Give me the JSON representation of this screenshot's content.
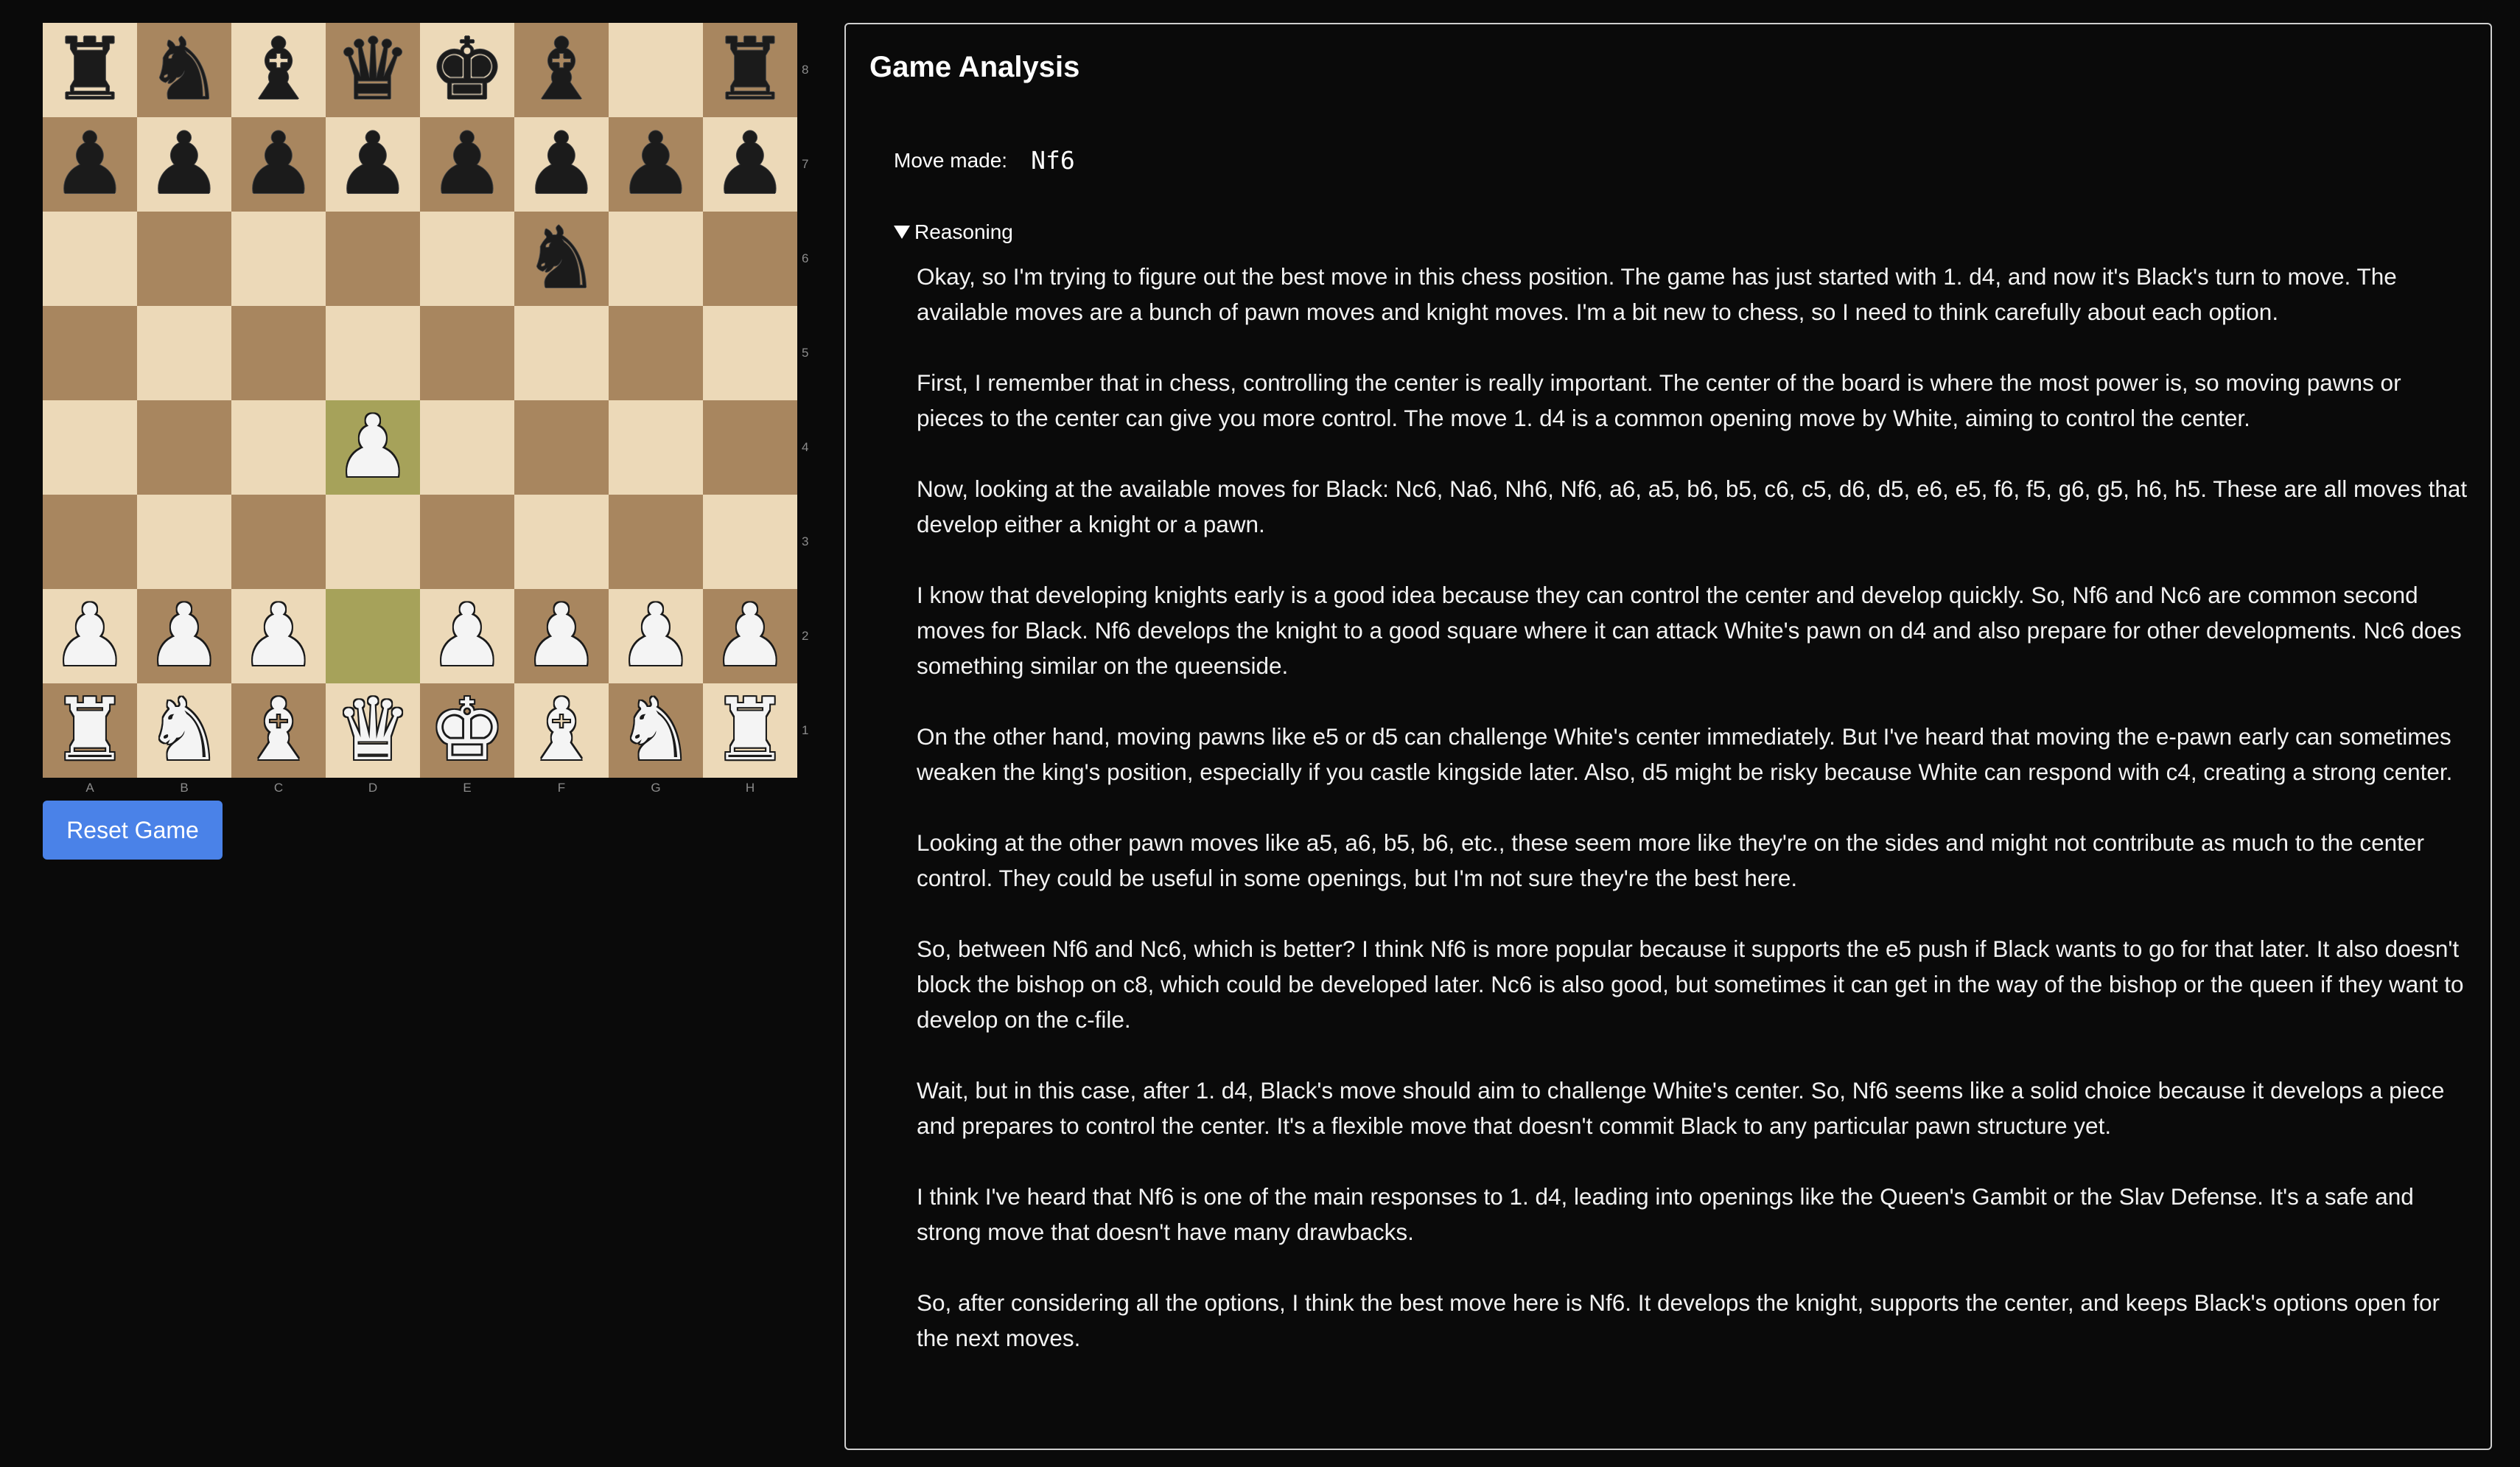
{
  "board": {
    "files": [
      "A",
      "B",
      "C",
      "D",
      "E",
      "F",
      "G",
      "H"
    ],
    "ranks": [
      "8",
      "7",
      "6",
      "5",
      "4",
      "3",
      "2",
      "1"
    ],
    "rows": [
      [
        "r",
        "n",
        "b",
        "q",
        "k",
        "b",
        "",
        "r"
      ],
      [
        "p",
        "p",
        "p",
        "p",
        "p",
        "p",
        "p",
        "p"
      ],
      [
        "",
        "",
        "",
        "",
        "",
        "n",
        "",
        ""
      ],
      [
        "",
        "",
        "",
        "",
        "",
        "",
        "",
        ""
      ],
      [
        "",
        "",
        "",
        "P",
        "",
        "",
        "",
        ""
      ],
      [
        "",
        "",
        "",
        "",
        "",
        "",
        "",
        ""
      ],
      [
        "P",
        "P",
        "P",
        "",
        "P",
        "P",
        "P",
        "P"
      ],
      [
        "R",
        "N",
        "B",
        "Q",
        "K",
        "B",
        "N",
        "R"
      ]
    ],
    "highlighted": [
      "d4",
      "d2"
    ],
    "colors": {
      "light": "#ecd9b8",
      "dark": "#a8865f",
      "highlight": "#a6a25a"
    }
  },
  "reset_button": {
    "label": "Reset Game",
    "color": "#4a82e8"
  },
  "analysis": {
    "title": "Game Analysis",
    "move_label": "Move made:",
    "move_value": "Nf6",
    "reasoning_label": "Reasoning",
    "paragraphs": [
      "Okay, so I'm trying to figure out the best move in this chess position. The game has just started with 1. d4, and now it's Black's turn to move. The available moves are a bunch of pawn moves and knight moves. I'm a bit new to chess, so I need to think carefully about each option.",
      "First, I remember that in chess, controlling the center is really important. The center of the board is where the most power is, so moving pawns or pieces to the center can give you more control. The move 1. d4 is a common opening move by White, aiming to control the center.",
      "Now, looking at the available moves for Black: Nc6, Na6, Nh6, Nf6, a6, a5, b6, b5, c6, c5, d6, d5, e6, e5, f6, f5, g6, g5, h6, h5. These are all moves that develop either a knight or a pawn.",
      "I know that developing knights early is a good idea because they can control the center and develop quickly. So, Nf6 and Nc6 are common second moves for Black. Nf6 develops the knight to a good square where it can attack White's pawn on d4 and also prepare for other developments. Nc6 does something similar on the queenside.",
      "On the other hand, moving pawns like e5 or d5 can challenge White's center immediately. But I've heard that moving the e-pawn early can sometimes weaken the king's position, especially if you castle kingside later. Also, d5 might be risky because White can respond with c4, creating a strong center.",
      "Looking at the other pawn moves like a5, a6, b5, b6, etc., these seem more like they're on the sides and might not contribute as much to the center control. They could be useful in some openings, but I'm not sure they're the best here.",
      "So, between Nf6 and Nc6, which is better? I think Nf6 is more popular because it supports the e5 push if Black wants to go for that later. It also doesn't block the bishop on c8, which could be developed later. Nc6 is also good, but sometimes it can get in the way of the bishop or the queen if they want to develop on the c-file.",
      "Wait, but in this case, after 1. d4, Black's move should aim to challenge White's center. So, Nf6 seems like a solid choice because it develops a piece and prepares to control the center. It's a flexible move that doesn't commit Black to any particular pawn structure yet.",
      "I think I've heard that Nf6 is one of the main responses to 1. d4, leading into openings like the Queen's Gambit or the Slav Defense. It's a safe and strong move that doesn't have many drawbacks.",
      "So, after considering all the options, I think the best move here is Nf6. It develops the knight, supports the center, and keeps Black's options open for the next moves."
    ]
  }
}
